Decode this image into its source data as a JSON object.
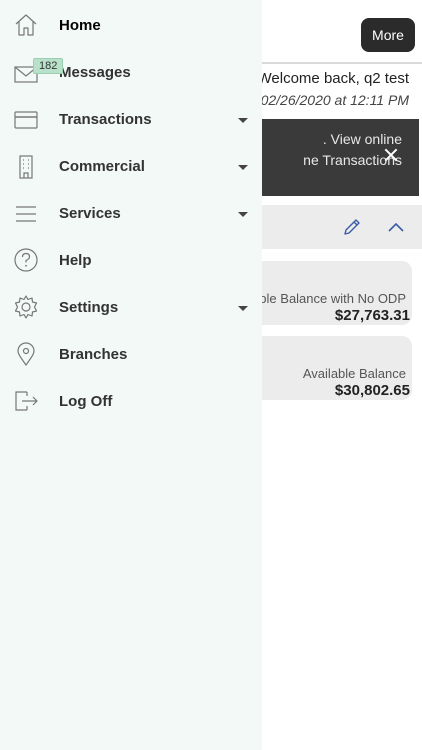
{
  "header": {
    "more_label": "More"
  },
  "welcome": {
    "greeting": "Welcome back, q2 test",
    "last_login": "02/26/2020 at 12:11 PM"
  },
  "alert": {
    "line1": ". View online",
    "line2": "ne Transactions"
  },
  "accounts": [
    {
      "label": "able Balance with No ODP",
      "value": "$27,763.31"
    },
    {
      "label": "Available Balance",
      "value": "$30,802.65"
    }
  ],
  "menu": {
    "items": [
      {
        "label": "Home",
        "icon": "home-icon",
        "active": true
      },
      {
        "label": "Messages",
        "icon": "envelope-icon",
        "badge": "182"
      },
      {
        "label": "Transactions",
        "icon": "credit-card-icon",
        "has_submenu": true
      },
      {
        "label": "Commercial",
        "icon": "building-icon",
        "has_submenu": true
      },
      {
        "label": "Services",
        "icon": "list-icon",
        "has_submenu": true
      },
      {
        "label": "Help",
        "icon": "question-circle-icon"
      },
      {
        "label": "Settings",
        "icon": "gear-icon",
        "has_submenu": true
      },
      {
        "label": "Branches",
        "icon": "map-pin-icon"
      },
      {
        "label": "Log Off",
        "icon": "logout-icon"
      }
    ]
  },
  "colors": {
    "drawer_bg": "#f3f9f7",
    "badge_bg": "#b9e0c9",
    "banner_bg": "#3a3a3a",
    "card_bg": "#ececec"
  }
}
